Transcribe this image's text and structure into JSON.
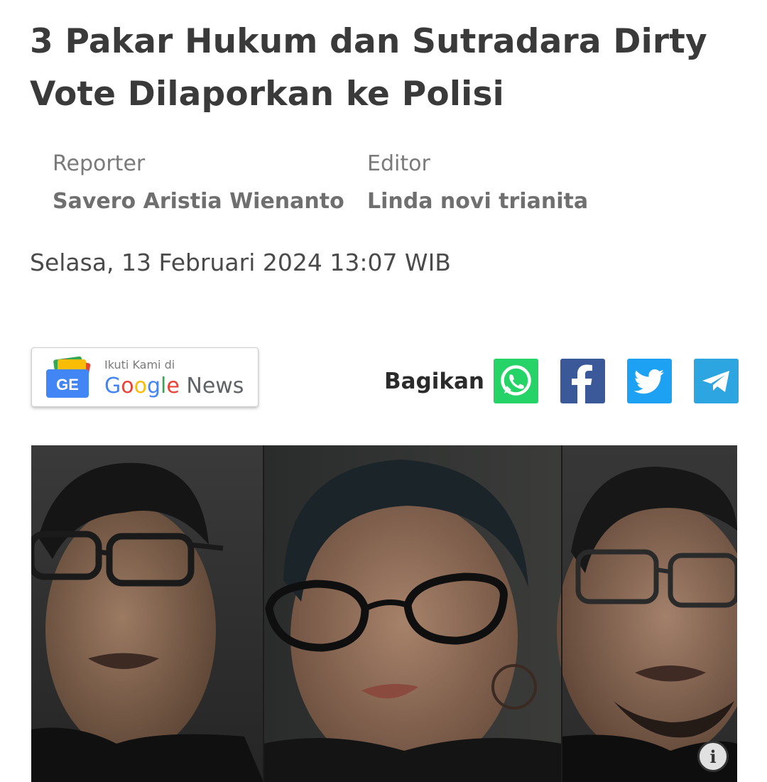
{
  "article": {
    "title": "3 Pakar Hukum dan Sutradara Dirty Vote Dilaporkan ke Polisi",
    "reporter_label": "Reporter",
    "reporter_name": "Savero Aristia Wienanto",
    "editor_label": "Editor",
    "editor_name": "Linda novi trianita",
    "date": "Selasa, 13 Februari 2024 13:07 WIB"
  },
  "google_news": {
    "small_text": "Ikuti Kami di",
    "logo_letters": "GE",
    "brand": [
      "G",
      "o",
      "o",
      "g",
      "l",
      "e"
    ],
    "news": "News"
  },
  "share": {
    "label": "Bagikan",
    "buttons": [
      {
        "name": "whatsapp",
        "icon": "whatsapp-icon",
        "color": "#25D366"
      },
      {
        "name": "facebook",
        "icon": "facebook-icon",
        "color": "#3b5998"
      },
      {
        "name": "twitter",
        "icon": "twitter-icon",
        "color": "#1da1f2"
      },
      {
        "name": "telegram",
        "icon": "telegram-icon",
        "color": "#2ca5e0"
      }
    ]
  },
  "photo": {
    "icon": "info-icon",
    "info_glyph": "i"
  }
}
